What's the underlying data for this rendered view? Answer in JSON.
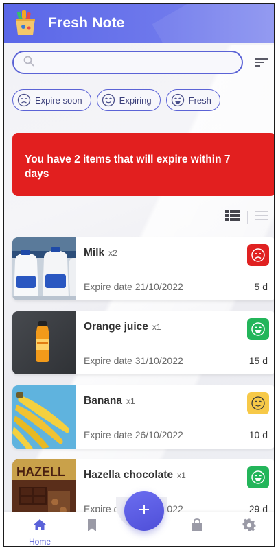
{
  "app": {
    "title": "Fresh Note"
  },
  "search": {
    "placeholder": ""
  },
  "filters": [
    {
      "label": "Expire soon",
      "face": "sad-face-icon"
    },
    {
      "label": "Expiring",
      "face": "neutral-face-icon"
    },
    {
      "label": "Fresh",
      "face": "happy-face-icon"
    }
  ],
  "alert": {
    "message": "You have 2 items that will expire within 7 days"
  },
  "items": [
    {
      "name": "Milk",
      "qty": "x2",
      "expire": "Expire date 21/10/2022",
      "days": "5 d",
      "status": "expire-soon",
      "status_color": "#e02121"
    },
    {
      "name": "Orange juice",
      "qty": "x1",
      "expire": "Expire date 31/10/2022",
      "days": "15 d",
      "status": "fresh",
      "status_color": "#23b55a"
    },
    {
      "name": "Banana",
      "qty": "x1",
      "expire": "Expire date 26/10/2022",
      "days": "10 d",
      "status": "expiring",
      "status_color": "#f7c948"
    },
    {
      "name": "Hazella chocolate",
      "qty": "x1",
      "expire": "Expire date 26/10/2022",
      "days": "29 d",
      "status": "fresh",
      "status_color": "#23b55a"
    }
  ],
  "bottom_nav": {
    "home_label": "Home",
    "active_color": "#5a62d9",
    "inactive_color": "#9a9aa6"
  },
  "colors": {
    "accent": "#5b63d6",
    "alert": "#e21f1f"
  }
}
